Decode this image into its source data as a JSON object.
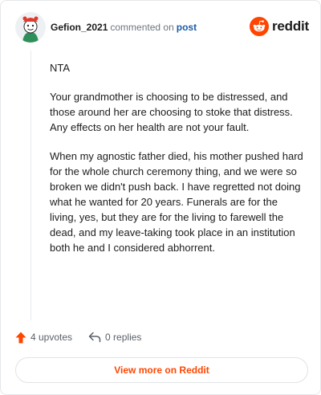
{
  "header": {
    "username": "Gefion_2021",
    "action_text": "commented on",
    "post_link": "post",
    "brand": "reddit"
  },
  "comment": {
    "paragraphs": [
      "NTA",
      "Your grandmother is choosing to be distressed, and those around her are choosing to stoke that distress. Any effects on her health are not your fault.",
      "When my agnostic father died, his mother pushed hard for the whole church ceremony thing, and we were so broken we didn't push back. I have regretted not doing what he wanted for 20 years. Funerals are for the living, yes, but they are for the living to farewell the dead, and my leave-taking took place in an institution both he and I considered abhorrent."
    ]
  },
  "actions": {
    "upvotes": "4 upvotes",
    "replies": "0 replies"
  },
  "footer": {
    "view_more": "View more on Reddit"
  },
  "colors": {
    "accent": "#ff4500",
    "link": "#1d5ca8"
  }
}
